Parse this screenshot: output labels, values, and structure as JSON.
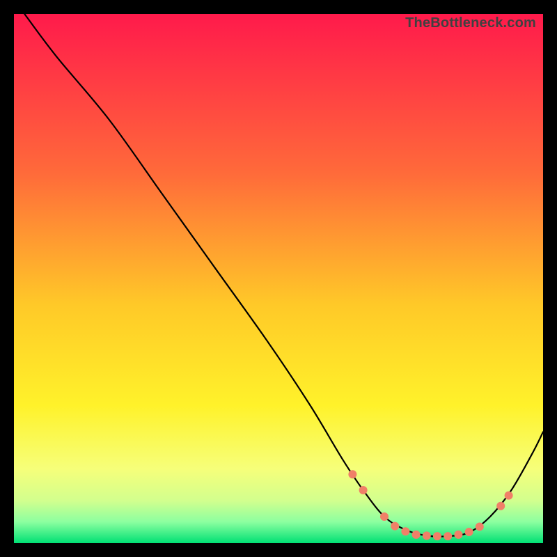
{
  "watermark": "TheBottleneck.com",
  "chart_data": {
    "type": "line",
    "title": "",
    "xlabel": "",
    "ylabel": "",
    "xlim": [
      0,
      100
    ],
    "ylim": [
      0,
      100
    ],
    "grid": false,
    "legend": false,
    "background_gradient": {
      "stops": [
        {
          "offset": 0.0,
          "color": "#ff1a4b"
        },
        {
          "offset": 0.3,
          "color": "#ff6a3a"
        },
        {
          "offset": 0.55,
          "color": "#ffc928"
        },
        {
          "offset": 0.74,
          "color": "#fff22a"
        },
        {
          "offset": 0.86,
          "color": "#f6ff7a"
        },
        {
          "offset": 0.92,
          "color": "#d2ff8e"
        },
        {
          "offset": 0.96,
          "color": "#8cffa0"
        },
        {
          "offset": 1.0,
          "color": "#00e074"
        }
      ]
    },
    "series": [
      {
        "name": "curve",
        "stroke": "#000000",
        "stroke_width": 2.2,
        "points": [
          {
            "x": 2,
            "y": 100
          },
          {
            "x": 8,
            "y": 92
          },
          {
            "x": 18,
            "y": 80
          },
          {
            "x": 28,
            "y": 66
          },
          {
            "x": 38,
            "y": 52
          },
          {
            "x": 48,
            "y": 38
          },
          {
            "x": 56,
            "y": 26
          },
          {
            "x": 62,
            "y": 16
          },
          {
            "x": 66,
            "y": 10
          },
          {
            "x": 70,
            "y": 5
          },
          {
            "x": 74,
            "y": 2.5
          },
          {
            "x": 78,
            "y": 1.4
          },
          {
            "x": 82,
            "y": 1.3
          },
          {
            "x": 86,
            "y": 2
          },
          {
            "x": 90,
            "y": 5
          },
          {
            "x": 94,
            "y": 10
          },
          {
            "x": 98,
            "y": 17
          },
          {
            "x": 100,
            "y": 21
          }
        ]
      }
    ],
    "markers": {
      "name": "dots",
      "color": "#f08068",
      "radius": 6,
      "points": [
        {
          "x": 64,
          "y": 13
        },
        {
          "x": 66,
          "y": 10
        },
        {
          "x": 70,
          "y": 5
        },
        {
          "x": 72,
          "y": 3.2
        },
        {
          "x": 74,
          "y": 2.2
        },
        {
          "x": 76,
          "y": 1.6
        },
        {
          "x": 78,
          "y": 1.4
        },
        {
          "x": 80,
          "y": 1.3
        },
        {
          "x": 82,
          "y": 1.3
        },
        {
          "x": 84,
          "y": 1.6
        },
        {
          "x": 86,
          "y": 2.1
        },
        {
          "x": 88,
          "y": 3.1
        },
        {
          "x": 92,
          "y": 7
        },
        {
          "x": 93.5,
          "y": 9
        }
      ]
    }
  }
}
